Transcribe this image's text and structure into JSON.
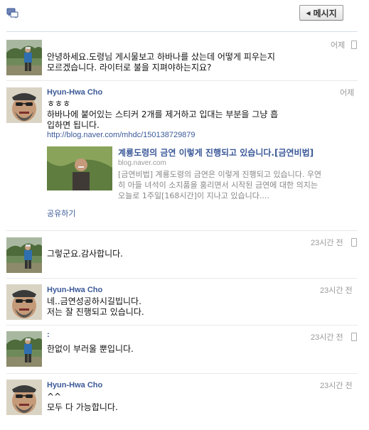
{
  "header": {
    "icon": "chat-bubbles-icon",
    "back_button_label": "메시지",
    "back_icon": "triangle-left-icon"
  },
  "messages": [
    {
      "sender": "",
      "avatar": "photo-man-outdoors",
      "time": "어제",
      "lines": [
        "안녕하세요.도령님 게시물보고 하바나를 샀는데 어떻게 피우는지",
        "모르겠습니다. 라이터로 불을 지펴야하는지요?"
      ],
      "device_icon": "mobile-phone-icon"
    },
    {
      "sender": "Hyun-Hwa Cho",
      "avatar": "photo-man-hat-sunglasses",
      "time": "어제",
      "lines": [
        "ㅎㅎㅎ",
        "하바나에 붙어있는 스티커 2개를 제거하고 입대는 부분을 그냥 흡",
        "입하면 됩니다."
      ],
      "link": "http://blog.naver.com/mhdc/150138729879",
      "attachment": {
        "title": "계룡도령의 금연 이렇게 진행되고 있습니다.[금연비법]",
        "domain": "blog.naver.com",
        "description": [
          "[금연비법] 계룡도령의 금연은 이렇게 진행되고 있습니다. 우연",
          "히 아들 녀석이 소지품을 훔리면서 시작된 금연에 대한 의지는",
          "오늘로 1주일[168시간]이 지나고 있습니다...."
        ]
      },
      "share_label": "공유하기"
    },
    {
      "sender": "",
      "avatar": "photo-man-outdoors",
      "time": "23시간 전",
      "lines": [
        "그렇군요.감사합니다."
      ],
      "device_icon": "mobile-phone-icon"
    },
    {
      "sender": "Hyun-Hwa Cho",
      "avatar": "photo-man-hat-sunglasses",
      "time": "23시간 전",
      "lines": [
        "네..금연성공하시길빕니다.",
        "저는 잘 진행되고 있습니다."
      ]
    },
    {
      "sender": ":",
      "avatar": "photo-man-outdoors",
      "time": "23시간 전",
      "lines": [
        "한없이 부러울 뿐입니다."
      ],
      "device_icon": "mobile-phone-icon"
    },
    {
      "sender": "Hyun-Hwa Cho",
      "avatar": "photo-man-hat-sunglasses",
      "time": "23시간 전",
      "lines": [
        "^^",
        "모두 다 가능합니다."
      ]
    }
  ],
  "colors": {
    "link_blue": "#3b5998",
    "timestamp_gray": "#999999",
    "divider": "#e9e9e9"
  }
}
